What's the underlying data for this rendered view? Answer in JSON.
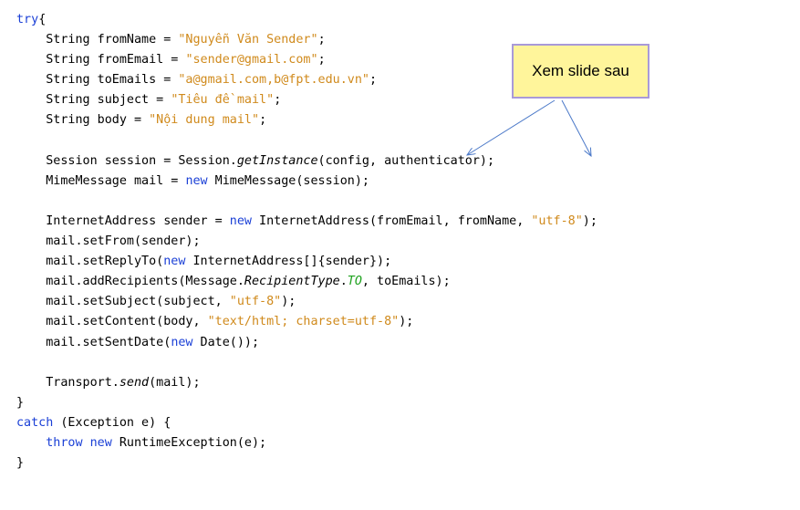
{
  "callout": {
    "text": "Xem slide sau"
  },
  "code": {
    "lines": [
      [
        [
          "kw",
          "try"
        ],
        [
          "",
          "{"
        ]
      ],
      [
        [
          "",
          "    String fromName = "
        ],
        [
          "str",
          "\"Nguyễn Văn Sender\""
        ],
        [
          "",
          ";"
        ]
      ],
      [
        [
          "",
          "    String fromEmail = "
        ],
        [
          "str",
          "\"sender@gmail.com\""
        ],
        [
          "",
          ";"
        ]
      ],
      [
        [
          "",
          "    String toEmails = "
        ],
        [
          "str",
          "\"a@gmail.com,b@fpt.edu.vn\""
        ],
        [
          "",
          ";"
        ]
      ],
      [
        [
          "",
          "    String subject = "
        ],
        [
          "str",
          "\"Tiêu đề mail\""
        ],
        [
          "",
          ";"
        ]
      ],
      [
        [
          "",
          "    String body = "
        ],
        [
          "str",
          "\"Nội dung mail\""
        ],
        [
          "",
          ";"
        ]
      ],
      [],
      [
        [
          "",
          "    Session session = Session."
        ],
        [
          "it",
          "getInstance"
        ],
        [
          "",
          "(config, authenticator);"
        ]
      ],
      [
        [
          "",
          "    MimeMessage mail = "
        ],
        [
          "kw",
          "new"
        ],
        [
          "",
          " MimeMessage(session);"
        ]
      ],
      [],
      [
        [
          "",
          "    InternetAddress sender = "
        ],
        [
          "kw",
          "new"
        ],
        [
          "",
          " InternetAddress(fromEmail, fromName, "
        ],
        [
          "str",
          "\"utf-8\""
        ],
        [
          "",
          ");"
        ]
      ],
      [
        [
          "",
          "    mail.setFrom(sender);"
        ]
      ],
      [
        [
          "",
          "    mail.setReplyTo("
        ],
        [
          "kw",
          "new"
        ],
        [
          "",
          " InternetAddress[]{sender});"
        ]
      ],
      [
        [
          "",
          "    mail.addRecipients(Message."
        ],
        [
          "it",
          "RecipientType"
        ],
        [
          "",
          "."
        ],
        [
          "itg",
          "TO"
        ],
        [
          "",
          ", toEmails);"
        ]
      ],
      [
        [
          "",
          "    mail.setSubject(subject, "
        ],
        [
          "str",
          "\"utf-8\""
        ],
        [
          "",
          ");"
        ]
      ],
      [
        [
          "",
          "    mail.setContent(body, "
        ],
        [
          "str",
          "\"text/html; charset=utf-8\""
        ],
        [
          "",
          ");"
        ]
      ],
      [
        [
          "",
          "    mail.setSentDate("
        ],
        [
          "kw",
          "new"
        ],
        [
          "",
          " Date());"
        ]
      ],
      [],
      [
        [
          "",
          "    Transport."
        ],
        [
          "it",
          "send"
        ],
        [
          "",
          "(mail);"
        ]
      ],
      [
        [
          "",
          "}"
        ]
      ],
      [
        [
          "kw",
          "catch"
        ],
        [
          "",
          " (Exception e) {"
        ]
      ],
      [
        [
          "",
          "    "
        ],
        [
          "kw",
          "throw"
        ],
        [
          "",
          " "
        ],
        [
          "kw",
          "new"
        ],
        [
          "",
          " RuntimeException(e);"
        ]
      ],
      [
        [
          "",
          "}"
        ]
      ]
    ]
  },
  "colors": {
    "keyword": "#1a3fd6",
    "string": "#d08a1c",
    "constant": "#1fa21f",
    "callout_fill": "#fff59b",
    "callout_border": "#a99ad8",
    "arrow": "#4a78c8"
  }
}
